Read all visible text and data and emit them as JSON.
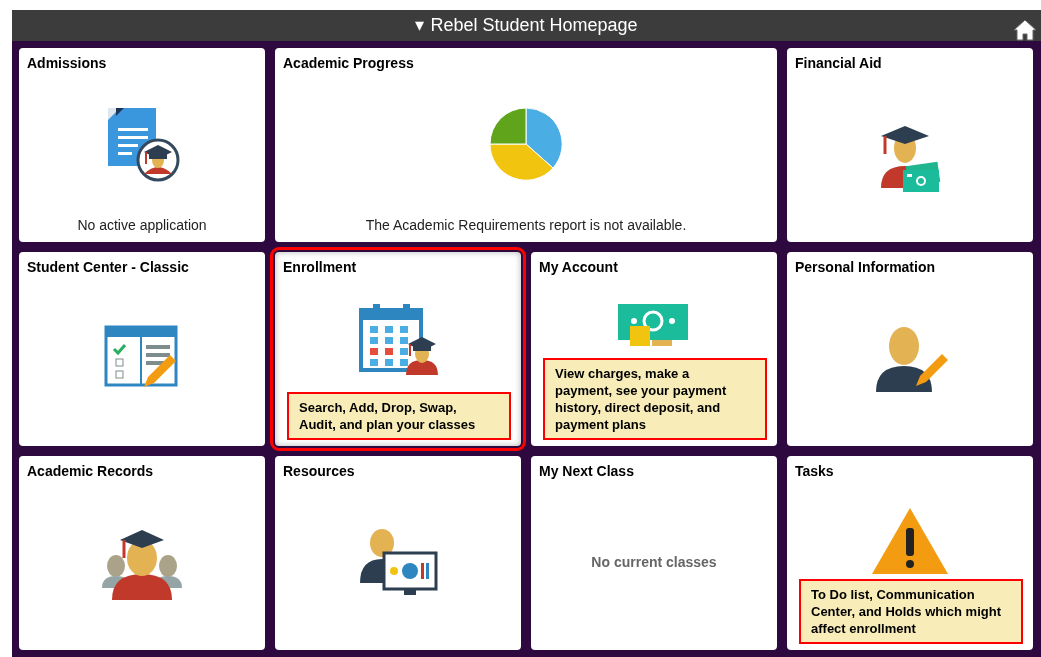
{
  "header": {
    "caret": "▾",
    "title": "Rebel Student Homepage"
  },
  "tiles": [
    {
      "title": "Admissions",
      "kind": "document-student",
      "message": "No active application",
      "wide": false,
      "highlighted": false
    },
    {
      "title": "Academic Progress",
      "kind": "pie",
      "message": "The Academic Requirements report is not available.",
      "wide": true,
      "highlighted": false
    },
    {
      "title": "Financial Aid",
      "kind": "graduate-card",
      "wide": false,
      "highlighted": false
    },
    {
      "title": "Student Center - Classic",
      "kind": "checklist",
      "wide": false,
      "highlighted": false
    },
    {
      "title": "Enrollment",
      "kind": "calendar-student",
      "callout": "Search, Add, Drop, Swap, Audit, and plan your classes",
      "wide": false,
      "highlighted": true
    },
    {
      "title": "My Account",
      "kind": "money",
      "callout": "View charges, make a payment, see your payment history, direct deposit, and payment plans",
      "wide": false,
      "highlighted": false
    },
    {
      "title": "Personal Information",
      "kind": "person-pencil",
      "wide": false,
      "highlighted": false
    },
    {
      "title": "Academic Records",
      "kind": "graduates",
      "wide": false,
      "highlighted": false
    },
    {
      "title": "Resources",
      "kind": "presentation",
      "wide": false,
      "highlighted": false
    },
    {
      "title": "My Next Class",
      "kind": "empty",
      "message": "No current classes",
      "wide": false,
      "highlighted": false
    },
    {
      "title": "Tasks",
      "kind": "warning",
      "callout": "To Do list, Communication Center, and Holds which might affect enrollment",
      "wide": false,
      "highlighted": false
    }
  ]
}
